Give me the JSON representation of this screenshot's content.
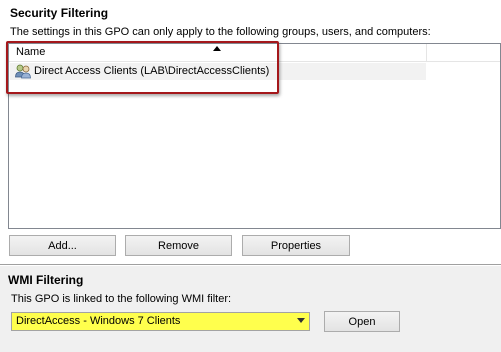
{
  "security_filtering": {
    "title": "Security Filtering",
    "description": "The settings in this GPO can only apply to the following groups, users, and computers:",
    "column_header": "Name",
    "items": [
      {
        "label": "Direct Access Clients (LAB\\DirectAccessClients)",
        "icon": "group-icon"
      }
    ],
    "buttons": {
      "add": "Add...",
      "remove": "Remove",
      "properties": "Properties"
    }
  },
  "wmi_filtering": {
    "title": "WMI Filtering",
    "description": "This GPO is linked to the following WMI filter:",
    "selected_filter": "DirectAccess - Windows 7 Clients",
    "open_button": "Open"
  },
  "colors": {
    "highlight_border": "#a4171b",
    "combo_highlight": "#ffff4d"
  }
}
